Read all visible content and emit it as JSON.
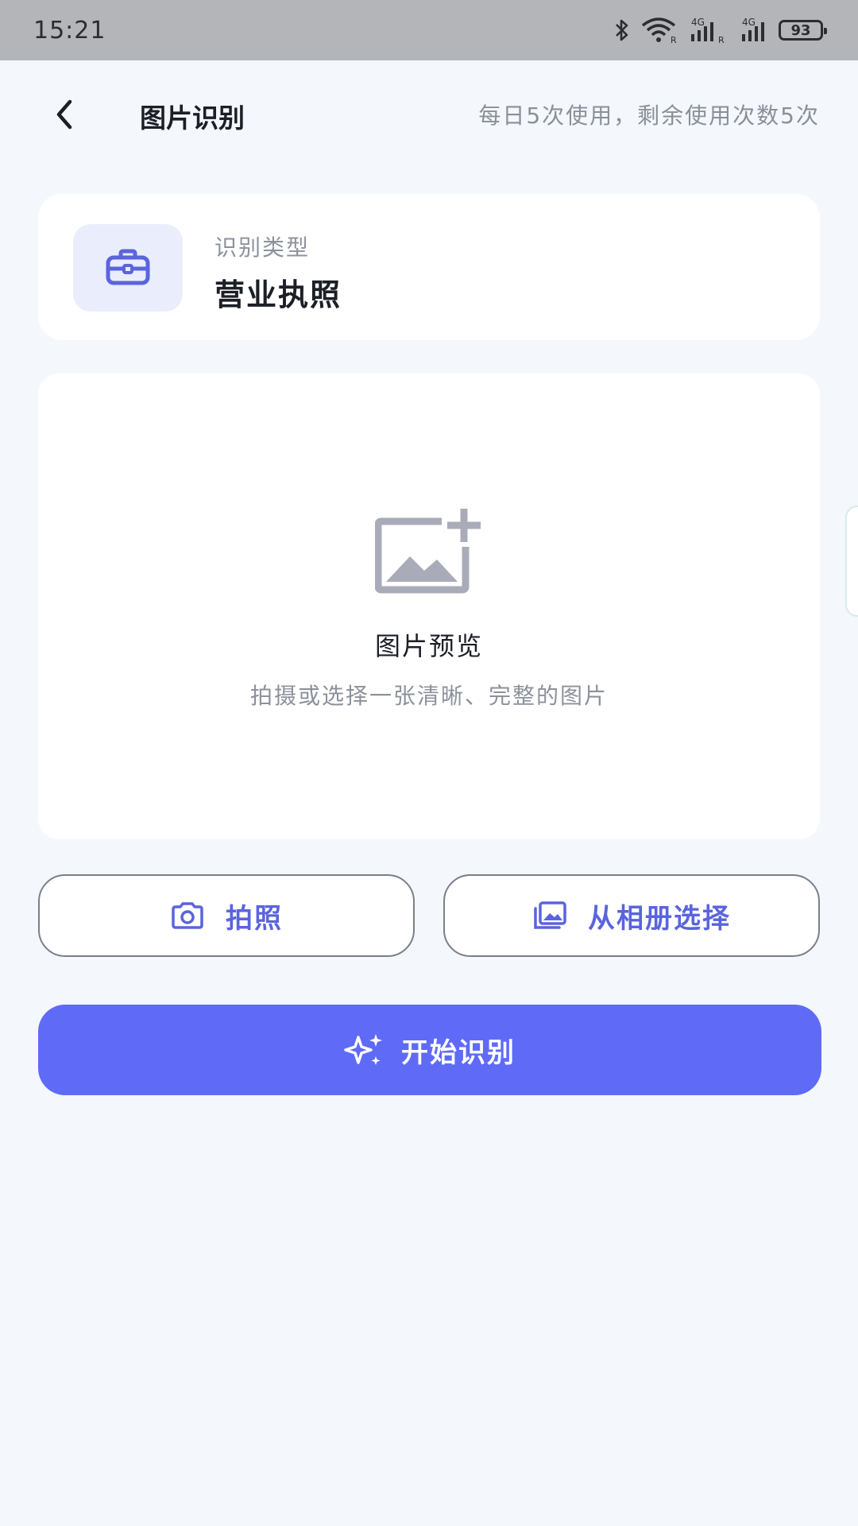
{
  "status_bar": {
    "time": "15:21",
    "battery": "93",
    "network_label": "4G"
  },
  "header": {
    "title": "图片识别",
    "usage": "每日5次使用，剩余使用次数5次"
  },
  "recognition_type": {
    "label": "识别类型",
    "value": "营业执照",
    "icon": "briefcase-icon"
  },
  "preview": {
    "title": "图片预览",
    "hint": "拍摄或选择一张清晰、完整的图片",
    "icon": "image-add-icon"
  },
  "actions": {
    "camera_label": "拍照",
    "album_label": "从相册选择",
    "start_label": "开始识别"
  },
  "colors": {
    "accent": "#5f6bf6",
    "accent_text": "#5a64de",
    "icon_bg": "#eaedfb",
    "page_bg": "#f4f7fb"
  }
}
